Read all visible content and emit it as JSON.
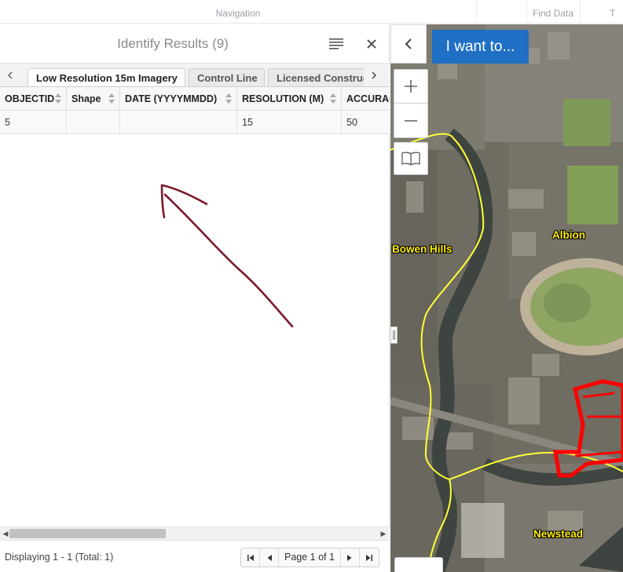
{
  "topbar": {
    "navigation": "Navigation",
    "find_data": "Find Data",
    "clipped": "T"
  },
  "panel": {
    "title": "Identify Results (9)"
  },
  "tabs": [
    {
      "label": "Low Resolution 15m Imagery",
      "active": true
    },
    {
      "label": "Control Line",
      "active": false
    },
    {
      "label": "Licensed Construction",
      "active": false
    }
  ],
  "grid": {
    "columns": [
      "OBJECTID",
      "Shape",
      "DATE (YYYYMMDD)",
      "RESOLUTION (M)",
      "ACCURACY"
    ],
    "rows": [
      [
        "5",
        "",
        "",
        "15",
        "50"
      ]
    ]
  },
  "footer": {
    "displaying": "Displaying 1 - 1 (Total: 1)",
    "page_info": "Page 1 of 1"
  },
  "map": {
    "i_want_to": "I want to...",
    "places": {
      "bowen_hills": "Bowen Hills",
      "albion": "Albion",
      "newstead": "Newstead"
    }
  },
  "colors": {
    "accent": "#1f6fc5",
    "boundary": "#ffff33",
    "highlight": "#ff0000",
    "annotation": "#7a1a2a",
    "place_label": "#ffee00"
  },
  "icons": [
    "list-icon",
    "close-icon",
    "chevron-left-icon",
    "chevron-right-icon",
    "zoom-in-icon",
    "zoom-out-icon",
    "book-icon",
    "first-page-icon",
    "prev-page-icon",
    "next-page-icon",
    "last-page-icon"
  ]
}
